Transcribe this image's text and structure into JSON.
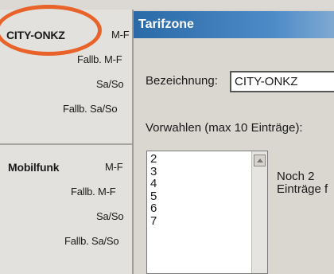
{
  "left_panel": {
    "group1": {
      "category": "CITY-ONKZ",
      "rows": [
        "M-F",
        "Fallb. M-F",
        "Sa/So",
        "Fallb. Sa/So"
      ]
    },
    "group2": {
      "category": "Mobilfunk",
      "rows": [
        "M-F",
        "Fallb. M-F",
        "Sa/So",
        "Fallb. Sa/So"
      ]
    }
  },
  "dialog": {
    "title": "Tarifzone",
    "name_label": "Bezeichnung:",
    "name_value": "CITY-ONKZ",
    "prefixes_label": "Vorwahlen (max 10 Einträge):",
    "prefixes": [
      "2",
      "3",
      "4",
      "5",
      "6",
      "7"
    ],
    "remaining_line1": "Noch 2",
    "remaining_line2": "Einträge f"
  },
  "colors": {
    "title_bar": "#2a6aa7",
    "highlight_circle": "#e8622a"
  },
  "icons": {
    "scroll_up": "scroll-up-arrow-icon"
  }
}
